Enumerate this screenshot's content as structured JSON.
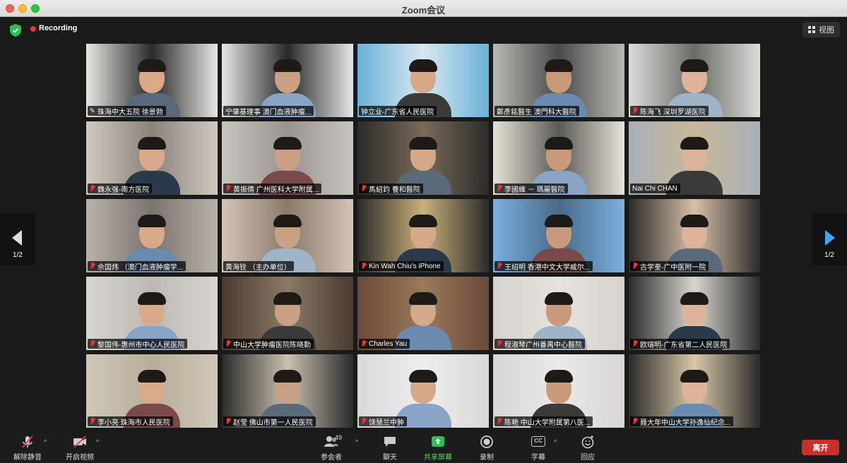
{
  "window": {
    "title": "Zoom会议"
  },
  "top": {
    "recording_label": "Recording",
    "view_label": "视图"
  },
  "pages": {
    "left": "1/2",
    "right": "1/2"
  },
  "participants": [
    {
      "name": "珠海中大五院 徐景勃",
      "icon": "pin-icon",
      "active": true
    },
    {
      "name": "宁肇基理事 澳门血液肿瘤...",
      "icon": "none"
    },
    {
      "name": "钟立业-广东省人民医院",
      "icon": "none"
    },
    {
      "name": "鄭彥銘醫生 澳門科大醫院",
      "icon": "none"
    },
    {
      "name": "陈海飞 深圳罗湖医院",
      "icon": "mic-muted-icon"
    },
    {
      "name": "魏永强-南方医院",
      "icon": "mic-muted-icon"
    },
    {
      "name": "黄振倩 广州医科大学附属...",
      "icon": "mic-muted-icon"
    },
    {
      "name": "馬紹鈞 養和醫院",
      "icon": "mic-muted-icon"
    },
    {
      "name": "李國維 － 瑪麗醫院",
      "icon": "mic-muted-icon"
    },
    {
      "name": "Nai Chi CHAN",
      "icon": "none"
    },
    {
      "name": "佘国炜 （澳门血液肿瘤学...",
      "icon": "mic-muted-icon"
    },
    {
      "name": "黄海铨 （主办单位）",
      "icon": "none"
    },
    {
      "name": "Kin Wah Chiu's iPhone",
      "icon": "mic-muted-icon"
    },
    {
      "name": "王绍明 香港中文大学威尔...",
      "icon": "mic-muted-icon"
    },
    {
      "name": "古学奎-广中医附一院",
      "icon": "mic-muted-icon"
    },
    {
      "name": "黎国伟-惠州市中心人民医院",
      "icon": "mic-muted-icon"
    },
    {
      "name": "中山大学肿瘤医院陈晓勤",
      "icon": "mic-muted-icon"
    },
    {
      "name": "Charles Yau",
      "icon": "mic-muted-icon"
    },
    {
      "name": "程淑琴广州番禺中心醫院",
      "icon": "mic-muted-icon"
    },
    {
      "name": "欧瑞明-广东省第二人民医院",
      "icon": "mic-muted-icon"
    },
    {
      "name": "李小亮 珠海市人民医院",
      "icon": "mic-muted-icon"
    },
    {
      "name": "赵莹 佛山市第一人民医院",
      "icon": "mic-muted-icon"
    },
    {
      "name": "饶慧兰中肿",
      "icon": "mic-muted-icon"
    },
    {
      "name": "陈艳 中山大学附属第八医...",
      "icon": "mic-muted-icon"
    },
    {
      "name": "聂大年中山大学孙逸仙纪念...",
      "icon": "mic-muted-icon"
    }
  ],
  "toolbar": {
    "unmute": "解除静音",
    "start_video": "开启视频",
    "participants": "参会者",
    "participants_count": "49",
    "chat": "聊天",
    "share": "共享屏幕",
    "record": "录制",
    "captions": "字幕",
    "captions_badge": "CC",
    "reactions": "回应",
    "leave": "离开"
  },
  "colors": {
    "accent_green": "#5cd65c",
    "leave_red": "#c9302c",
    "active_border": "#c7e06a",
    "nav_blue": "#3da5ff"
  }
}
